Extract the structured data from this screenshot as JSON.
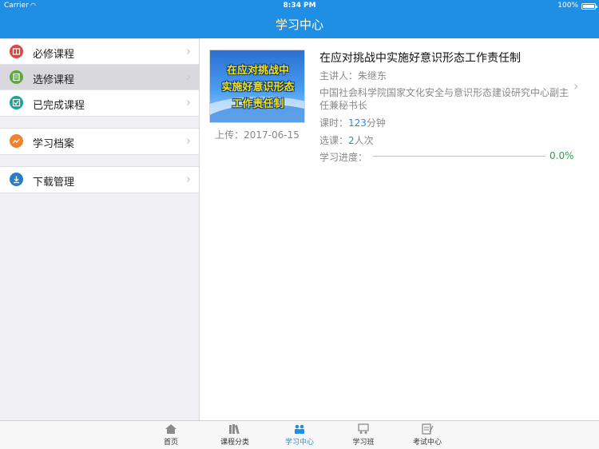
{
  "status_bar": {
    "carrier": "Carrier",
    "time": "8:34 PM",
    "battery": "100%"
  },
  "header": {
    "title": "学习中心"
  },
  "sidebar": {
    "groups": [
      [
        {
          "label": "必修课程",
          "icon": "book-icon",
          "color": "#e0463a"
        },
        {
          "label": "选修课程",
          "icon": "elective-icon",
          "color": "#5aaa3c"
        },
        {
          "label": "已完成课程",
          "icon": "check-icon",
          "color": "#17a3a1"
        }
      ],
      [
        {
          "label": "学习档案",
          "icon": "archive-icon",
          "color": "#f0832a"
        }
      ],
      [
        {
          "label": "下载管理",
          "icon": "download-icon",
          "color": "#2a7bc8"
        }
      ]
    ]
  },
  "course": {
    "thumb_lines": [
      "在应对挑战中",
      "实施好意识形态",
      "工作责任制"
    ],
    "upload": "上传：2017-06-15",
    "title": "在应对挑战中实施好意识形态工作责任制",
    "lecturer_label": "主讲人：",
    "lecturer": "朱继东",
    "description": "中国社会科学院国家文化安全与意识形态建设研究中心副主任兼秘书长",
    "hours_label": "课时：",
    "hours": "123",
    "hours_unit": "分钟",
    "enroll_label": "选课：",
    "enroll": "2",
    "enroll_unit": "人次",
    "progress_label": "学习进度：",
    "progress": "0.0%",
    "progress_fraction": 0.0
  },
  "tabbar": {
    "tabs": [
      {
        "label": "首页",
        "icon": "home-icon"
      },
      {
        "label": "课程分类",
        "icon": "books-icon"
      },
      {
        "label": "学习中心",
        "icon": "learning-center-icon"
      },
      {
        "label": "学习班",
        "icon": "class-icon"
      },
      {
        "label": "考试中心",
        "icon": "exam-icon"
      }
    ],
    "active_index": 2
  },
  "colors": {
    "accent": "#1f8fe6",
    "progress": "#2aa34a"
  }
}
